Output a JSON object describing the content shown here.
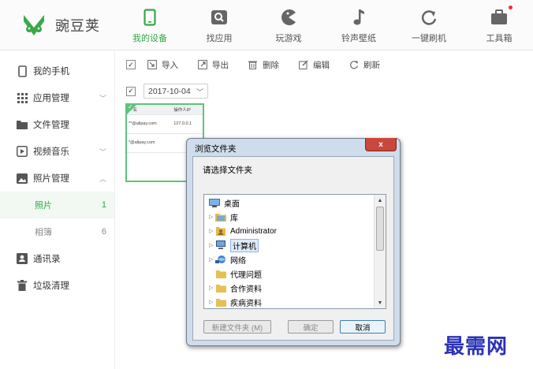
{
  "app": {
    "name": "豌豆荚",
    "colors": {
      "accent": "#37a64b",
      "selected_bg": "#f1f9f2",
      "watermark": "#2a32b8",
      "dialog_frame": "#cfdceb",
      "close_red": "#c9473b"
    }
  },
  "nav": [
    {
      "label": "我的设备",
      "icon": "phone-icon",
      "active": true
    },
    {
      "label": "找应用",
      "icon": "app-search-icon",
      "active": false
    },
    {
      "label": "玩游戏",
      "icon": "pacman-icon",
      "active": false
    },
    {
      "label": "铃声壁纸",
      "icon": "music-note-icon",
      "active": false
    },
    {
      "label": "一键刷机",
      "icon": "refresh-icon",
      "active": false
    },
    {
      "label": "工具箱",
      "icon": "toolbox-icon",
      "active": false
    }
  ],
  "sidebar": {
    "items": [
      {
        "label": "我的手机",
        "icon": "phone-icon"
      },
      {
        "label": "应用管理",
        "icon": "grid-icon",
        "chevron": "down"
      },
      {
        "label": "文件管理",
        "icon": "folder-icon"
      },
      {
        "label": "视频音乐",
        "icon": "play-icon",
        "chevron": "down"
      },
      {
        "label": "照片管理",
        "icon": "image-icon",
        "chevron": "up"
      },
      {
        "label": "照片",
        "count": "1",
        "sub": true,
        "selected": true
      },
      {
        "label": "相簿",
        "count": "6",
        "sub": true,
        "selected": false
      },
      {
        "label": "通讯录",
        "icon": "contacts-icon"
      },
      {
        "label": "垃圾清理",
        "icon": "trash-icon"
      }
    ]
  },
  "toolbar": {
    "import_label": "导入",
    "export_label": "导出",
    "delete_label": "删除",
    "edit_label": "编辑",
    "refresh_label": "刷新"
  },
  "date_filter": {
    "value": "2017-10-04"
  },
  "thumbnail": {
    "header": [
      "户名",
      "操作人IP"
    ],
    "rows": [
      [
        "**@alipay.com",
        "127.0.0.1"
      ],
      [
        "*@alipay.com",
        ""
      ]
    ]
  },
  "dialog": {
    "title": "浏览文件夹",
    "close_label": "x",
    "prompt": "请选择文件夹",
    "tree": [
      {
        "label": "桌面",
        "icon": "desktop-icon",
        "indent": 0,
        "has_children": false
      },
      {
        "label": "库",
        "icon": "library-icon",
        "indent": 1,
        "has_children": true
      },
      {
        "label": "Administrator",
        "icon": "user-folder-icon",
        "indent": 1,
        "has_children": true
      },
      {
        "label": "计算机",
        "icon": "computer-icon",
        "indent": 1,
        "has_children": true,
        "selected": true
      },
      {
        "label": "网络",
        "icon": "network-icon",
        "indent": 1,
        "has_children": true
      },
      {
        "label": "代理问题",
        "icon": "folder-icon",
        "indent": 1,
        "has_children": false
      },
      {
        "label": "合作资料",
        "icon": "folder-icon",
        "indent": 1,
        "has_children": true
      },
      {
        "label": "疾病资料",
        "icon": "folder-icon",
        "indent": 1,
        "has_children": true
      }
    ],
    "new_folder_label": "新建文件夹 (M)",
    "ok_label": "确定",
    "cancel_label": "取消"
  },
  "watermark": "最需网"
}
